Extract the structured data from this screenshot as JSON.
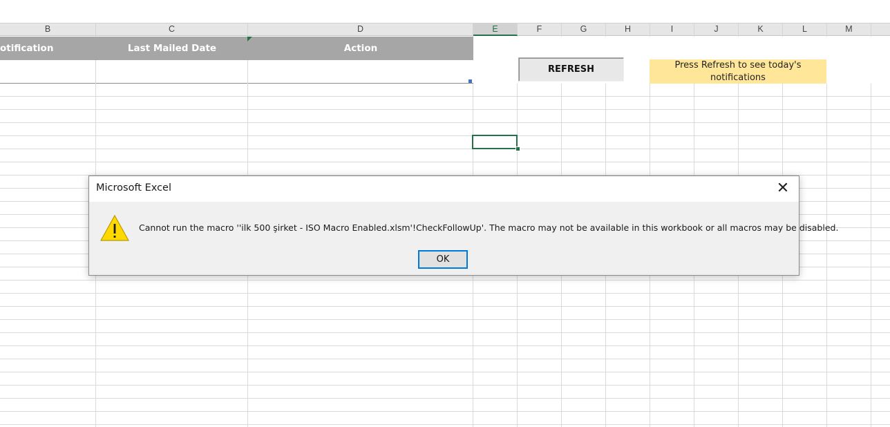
{
  "columns": {
    "b": "B",
    "c": "C",
    "d": "D",
    "e": "E",
    "f": "F",
    "g": "G",
    "h": "H",
    "i": "I",
    "j": "J",
    "k": "K",
    "l": "L",
    "m": "M"
  },
  "table_header": {
    "notification": "otification",
    "last_mailed_date": "Last Mailed Date",
    "action": "Action"
  },
  "refresh_button": "REFRESH",
  "note": {
    "line1": "Press Refresh to see today's",
    "line2": "notifications"
  },
  "dialog": {
    "title": "Microsoft Excel",
    "close_glyph": "✕",
    "message": "Cannot run the macro ''ilk 500 şirket - ISO Macro Enabled.xlsm'!CheckFollowUp'. The macro may not be available in this workbook or all macros may be disabled.",
    "ok_label": "OK",
    "icon": "warning-icon"
  },
  "colors": {
    "accent": "#217346",
    "header_band": "#a6a6a6",
    "note_fill": "#ffe699",
    "ok_border": "#0078d7"
  }
}
